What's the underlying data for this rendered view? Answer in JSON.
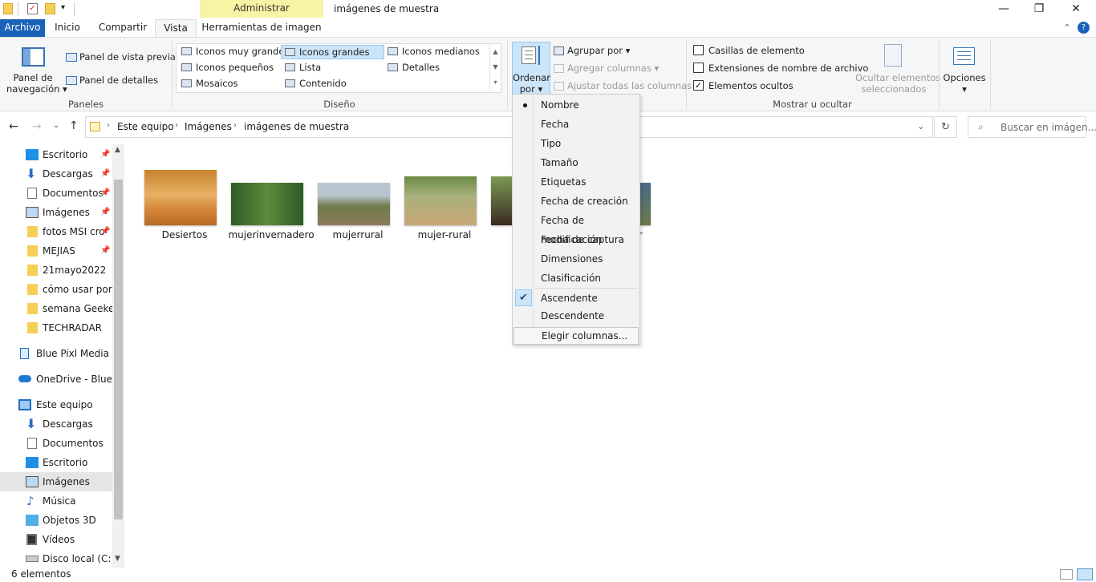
{
  "window": {
    "title": "imágenes de muestra",
    "context_tab_header": "Administrar",
    "minimize": "—",
    "restore": "❐",
    "close": "✕"
  },
  "tabs": {
    "archivo": "Archivo",
    "inicio": "Inicio",
    "compartir": "Compartir",
    "vista": "Vista",
    "herramientas": "Herramientas de imagen",
    "help": "?",
    "collapse": "⌃"
  },
  "ribbon": {
    "paneles": {
      "label": "Paneles",
      "nav_pane": "Panel de",
      "nav_pane_2": "navegación",
      "preview": "Panel de vista previa",
      "details": "Panel de detalles"
    },
    "diseno": {
      "label": "Diseño",
      "items": [
        "Iconos muy grandes",
        "Iconos grandes",
        "Iconos medianos",
        "Iconos pequeños",
        "Lista",
        "Detalles",
        "Mosaicos",
        "Contenido"
      ]
    },
    "vista_actual": {
      "ordenar": "Ordenar",
      "ordenar_2": "por",
      "agrupar": "Agrupar por",
      "agregar_columnas": "Agregar columnas",
      "ajustar": "Ajustar todas las columnas"
    },
    "mostrar": {
      "label": "Mostrar u ocultar",
      "casillas": "Casillas de elemento",
      "extensiones": "Extensiones de nombre de archivo",
      "ocultos": "Elementos ocultos",
      "ocultar_sel": "Ocultar elementos",
      "ocultar_sel_2": "seleccionados",
      "opciones": "Opciones"
    }
  },
  "address": {
    "crumbs": [
      "Este equipo",
      "Imágenes",
      "imágenes de muestra"
    ],
    "search_placeholder": "Buscar en imágen..."
  },
  "sidebar": {
    "items": [
      {
        "label": "Escritorio",
        "pinned": true
      },
      {
        "label": "Descargas",
        "pinned": true
      },
      {
        "label": "Documentos",
        "pinned": true
      },
      {
        "label": "Imágenes",
        "pinned": true
      },
      {
        "label": "fotos MSI cro",
        "pinned": true
      },
      {
        "label": "MEJIAS",
        "pinned": true
      },
      {
        "label": "21mayo2022",
        "pinned": false
      },
      {
        "label": "cómo usar porta",
        "pinned": false
      },
      {
        "label": "semana Geeked",
        "pinned": false
      },
      {
        "label": "TECHRADAR",
        "pinned": false
      },
      {
        "label": "Blue Pixl Media b.",
        "pinned": false
      },
      {
        "label": "OneDrive - Blue P",
        "pinned": false
      },
      {
        "label": "Este equipo",
        "pinned": false
      },
      {
        "label": "Descargas",
        "pinned": false
      },
      {
        "label": "Documentos",
        "pinned": false
      },
      {
        "label": "Escritorio",
        "pinned": false
      },
      {
        "label": "Imágenes",
        "pinned": false
      },
      {
        "label": "Música",
        "pinned": false
      },
      {
        "label": "Objetos 3D",
        "pinned": false
      },
      {
        "label": "Vídeos",
        "pinned": false
      },
      {
        "label": "Disco local (C:)",
        "pinned": false
      }
    ]
  },
  "files": [
    {
      "name": "Desiertos"
    },
    {
      "name": "mujerinvernadero"
    },
    {
      "name": "mujerrural"
    },
    {
      "name": "mujer-rural"
    },
    {
      "name": ""
    },
    {
      "name": "jer"
    }
  ],
  "sort_menu": {
    "fields": [
      "Nombre",
      "Fecha",
      "Tipo",
      "Tamaño",
      "Etiquetas",
      "Fecha de creación",
      "Fecha de modificación",
      "Fecha de captura",
      "Dimensiones",
      "Clasificación"
    ],
    "selected_field": "Nombre",
    "order": [
      "Ascendente",
      "Descendente"
    ],
    "selected_order": "Ascendente",
    "choose_columns": "Elegir columnas..."
  },
  "status": {
    "count": "6 elementos"
  },
  "colors": {
    "accent": "#1a63b8",
    "context_tab": "#f7f4a3",
    "selection": "#cce4f7"
  }
}
